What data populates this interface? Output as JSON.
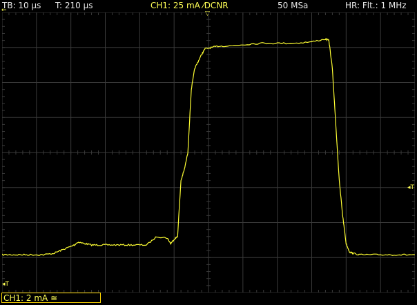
{
  "header": {
    "timebase": "TB: 10 µs",
    "trigger_time": "T: 210 µs",
    "channel_setting": "CH1: 25 mA ⁄DCNR",
    "sample_rate": "50 MSa",
    "filter": "HR: Flt.: 1 MHz"
  },
  "footer": {
    "channel_scale": "CH1: 2 mA ≅"
  },
  "markers": {
    "trigger_level": "◂T",
    "trigger_left": "◂T",
    "trigger_pos": "▽",
    "top_left": "←"
  },
  "colors": {
    "trace": "#ffff33",
    "grid": "#3a3a3a",
    "background": "#000000"
  },
  "chart_data": {
    "type": "line",
    "x_units": "µs",
    "y_units": "mA",
    "xlim": [
      0,
      120
    ],
    "ylim": [
      0,
      200
    ],
    "series": [
      {
        "values_x": [
          0,
          3,
          6,
          9,
          12,
          15,
          17,
          19,
          21,
          22,
          24,
          26,
          28,
          30,
          33,
          36,
          39,
          42,
          45,
          48,
          49,
          50,
          51,
          52,
          53,
          54,
          55,
          56,
          57,
          58,
          59,
          61,
          63,
          66,
          70,
          75,
          80,
          85,
          90,
          94,
          95,
          96,
          97,
          98,
          99,
          100,
          101,
          102,
          104,
          108,
          112,
          116,
          120
        ],
        "values_y": [
          27,
          27,
          27,
          27,
          27,
          28,
          30,
          32,
          34,
          36,
          35,
          34,
          34,
          34,
          34,
          34,
          34,
          34,
          40,
          39,
          35,
          38,
          40,
          80,
          88,
          100,
          145,
          160,
          165,
          170,
          174,
          175,
          176,
          176,
          177,
          178,
          178,
          178,
          179,
          181,
          180,
          160,
          120,
          80,
          55,
          35,
          29,
          28,
          27,
          27,
          27,
          27,
          27
        ]
      }
    ]
  }
}
